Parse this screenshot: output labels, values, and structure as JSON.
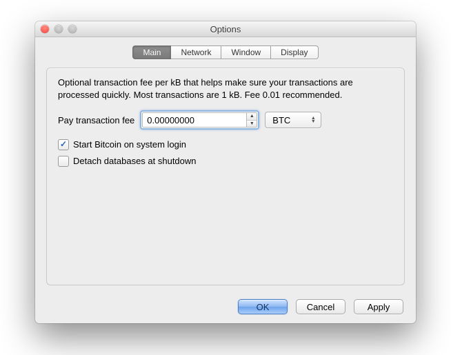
{
  "window": {
    "title": "Options"
  },
  "tabs": [
    {
      "label": "Main",
      "active": true
    },
    {
      "label": "Network",
      "active": false
    },
    {
      "label": "Window",
      "active": false
    },
    {
      "label": "Display",
      "active": false
    }
  ],
  "main": {
    "description": "Optional transaction fee per kB that helps make sure your transactions are processed quickly. Most transactions are 1 kB. Fee 0.01 recommended.",
    "fee_label": "Pay transaction fee",
    "fee_value": "0.00000000",
    "fee_unit": "BTC",
    "checks": [
      {
        "label": "Start Bitcoin on system login",
        "checked": true
      },
      {
        "label": "Detach databases at shutdown",
        "checked": false
      }
    ]
  },
  "buttons": {
    "ok": "OK",
    "cancel": "Cancel",
    "apply": "Apply"
  }
}
